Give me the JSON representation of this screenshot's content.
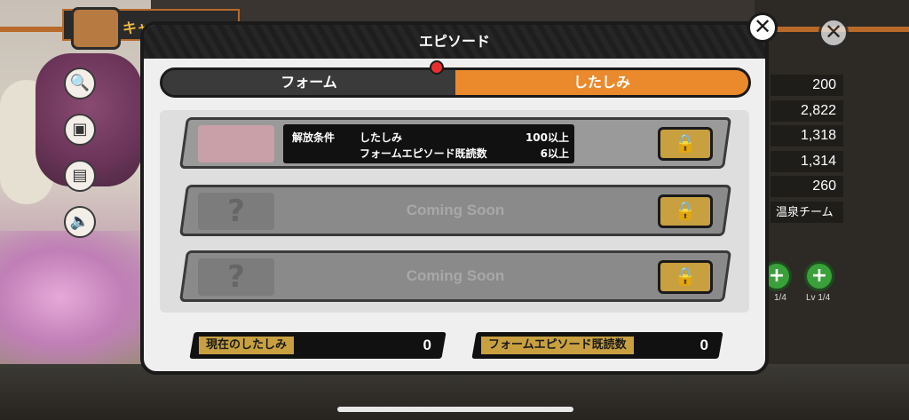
{
  "modal": {
    "title": "エピソード",
    "close_icon": "close-icon"
  },
  "tabs": [
    {
      "label": "フォーム",
      "active": false
    },
    {
      "label": "したしみ",
      "active": true
    }
  ],
  "episodes": [
    {
      "status": "unlocked-condition",
      "condition_label": "解放条件",
      "conditions": [
        {
          "name": "したしみ",
          "value": "100以上"
        },
        {
          "name": "フォームエピソード既読数",
          "value": "6以上"
        }
      ],
      "lock_icon": "lock-icon"
    },
    {
      "status": "coming-soon",
      "text": "Coming Soon",
      "placeholder": "?",
      "lock_icon": "lock-icon"
    },
    {
      "status": "coming-soon",
      "text": "Coming Soon",
      "placeholder": "?",
      "lock_icon": "lock-icon"
    }
  ],
  "counters": {
    "current_affinity_label": "現在のしたしみ",
    "current_affinity_value": "0",
    "form_episodes_read_label": "フォームエピソード既読数",
    "form_episodes_read_value": "0"
  },
  "background": {
    "banner_text": "キャ",
    "stats": [
      "200",
      "2,822",
      "1,318",
      "1,314",
      "260"
    ],
    "team_label": "温泉チーム",
    "lv_labels": [
      "1/4",
      "Lv 1/4"
    ]
  },
  "colors": {
    "accent_orange": "#ea8a2c",
    "lock_gold": "#c8a040",
    "header_dark": "#1e1e1e"
  }
}
